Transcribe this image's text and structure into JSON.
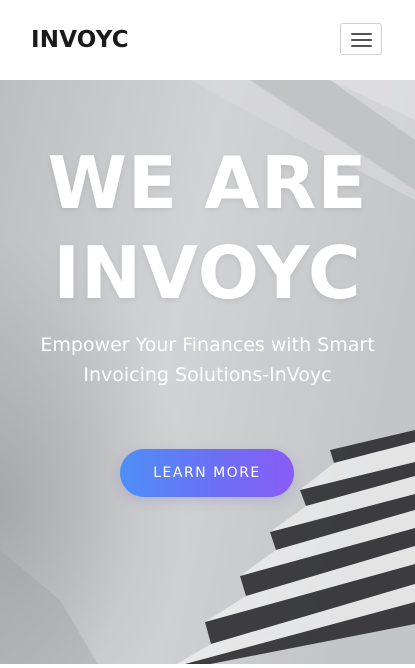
{
  "navbar": {
    "brand": "INVOYC",
    "menu_icon": "hamburger-menu-icon"
  },
  "hero": {
    "title_line1": "WE ARE",
    "title_line2": "INVOYC",
    "subtitle": "Empower Your Finances with Smart Invoicing Solutions-InVoyc",
    "cta_label": "LEARN MORE"
  },
  "colors": {
    "brand_text": "#1a1a1a",
    "cta_gradient_start": "#4f8ff7",
    "cta_gradient_end": "#8a5cf5",
    "hero_text": "#ffffff"
  }
}
